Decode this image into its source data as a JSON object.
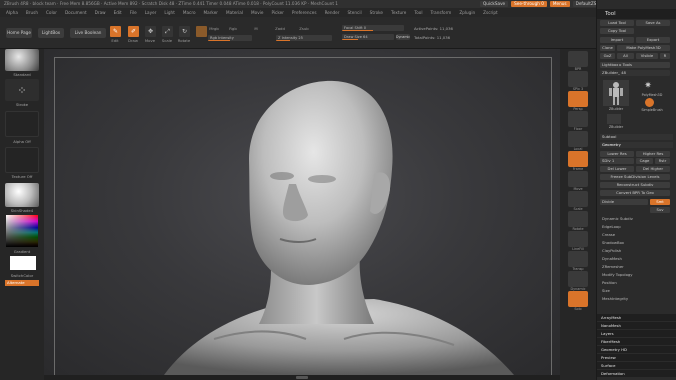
{
  "titlebar": {
    "text": "ZBrush 4R8  · block team  · Free Mem 8.856GB · Active Mem 892 · Scratch Disk 48 · ZTime 0.441 Timer 0.048 ATime 0.018 · PolyCount 11.036 KP · MeshCount 1",
    "quicksave": "QuickSave",
    "see_through": "See-through  0",
    "menus_label": "Menus",
    "default_script": "DefaultZScript"
  },
  "menubar": [
    "Alpha",
    "Brush",
    "Color",
    "Document",
    "Draw",
    "Edit",
    "File",
    "Layer",
    "Light",
    "Macro",
    "Marker",
    "Material",
    "Movie",
    "Picker",
    "Preferences",
    "Render",
    "Stencil",
    "Stroke",
    "Texture",
    "Tool",
    "Transform",
    "Zplugin",
    "Zscript"
  ],
  "toolbar": {
    "home_page": "Home Page",
    "lightbox": "LightBox",
    "live_boolean": "Live Boolean",
    "edit": "Edit",
    "draw": "Draw",
    "move": "Move",
    "scale": "Scale",
    "rotate": "Rotate",
    "mrgb": "Mrgb",
    "rgb": "Rgb",
    "m": "M",
    "zadd": "Zadd",
    "zsub": "Zsub",
    "rgb_intensity": "Rgb Intensity",
    "z_intensity": "Z Intensity  25",
    "focal_shift": "Focal Shift  0",
    "draw_size": "Draw Size  64",
    "dynamic": "Dynamic",
    "active_points": "ActivePoints: 11,036",
    "total_points": "TotalPoints: 11,036"
  },
  "left": {
    "brush": "Standard",
    "stroke": "Stroke",
    "alpha": "Alpha Off",
    "texture": "Texture Off",
    "material": "SkinShade4",
    "gradient": "Gradient",
    "switch_color": "SwitchColor",
    "alternate": "Alternate"
  },
  "right": {
    "items": [
      "BPR",
      "SPix 3",
      "Persp",
      "Floor",
      "Local",
      "Frame",
      "Move",
      "Scale",
      "Rotate",
      "LineFill",
      "Transp",
      "Dynamic",
      "Solo"
    ]
  },
  "tray": {
    "title": "Tool",
    "load_tool": "Load Tool",
    "save_as": "Save As",
    "copy_tool": "Copy Tool",
    "import": "Import",
    "export": "Export",
    "clone": "Clone",
    "make_polymesh": "Make PolyMesh3D",
    "goz": "GoZ",
    "all": "All",
    "visible": "Visible",
    "r": "R",
    "lightbox_tools": "Lightbox ▸ Tools",
    "zbuilder_slider": "ZBuilder_  48",
    "zbuilder_a": "ZBuilder",
    "polymesh3d": "PolyMesh3D",
    "simplebrush": "SimpleBrush",
    "zbuilder_b": "ZBuilder",
    "subtool": "Subtool",
    "geometry": "Geometry",
    "lower_res": "Lower Res",
    "higher_res": "Higher Res",
    "sdiv": "SDiv  1",
    "cage": "Cage",
    "rstr": "Rstr",
    "del_lower": "Del Lower",
    "del_higher": "Del Higher",
    "freeze_subdiv": "Freeze SubDivision Levels",
    "reconstruct_subdiv": "Reconstruct Subdiv",
    "convert_bpr": "Convert BPR To Geo",
    "divide": "Divide",
    "smt": "Smt",
    "suv": "Suv",
    "dynamic_subdiv": "Dynamic Subdiv",
    "edgeloop": "EdgeLoop",
    "crease": "Crease",
    "shadowbox": "ShadowBox",
    "claypolish": "ClayPolish",
    "dynamesh": "DynaMesh",
    "zremesher": "ZRemesher",
    "modify_topology": "Modify Topology",
    "position": "Position",
    "size": "Size",
    "meshintegrity": "MeshIntegrity",
    "sections": [
      "ArrayMesh",
      "NanoMesh",
      "Layers",
      "FiberMesh",
      "Geometry HD",
      "Preview",
      "Surface",
      "Deformation"
    ]
  }
}
